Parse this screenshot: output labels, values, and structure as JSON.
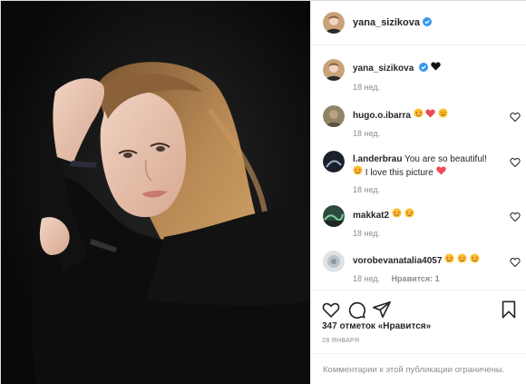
{
  "post": {
    "username": "yana_sizikova",
    "caption_emoji": "black-heart",
    "caption_time": "18 нед."
  },
  "comments": [
    {
      "user": "hugo.o.ibarra",
      "text": "",
      "emojis": [
        "star-struck",
        "red-heart",
        "smiling-face"
      ],
      "time": "18 нед.",
      "likes": ""
    },
    {
      "user": "l.anderbrau",
      "text": "You are so beautiful!",
      "text2": "I love this picture",
      "time": "18 нед.",
      "likes": ""
    },
    {
      "user": "makkat2",
      "text": "",
      "time": "18 нед.",
      "likes": ""
    },
    {
      "user": "vorobevanatalia4057",
      "text": "",
      "time": "18 нед.",
      "likes": "Нравится: 1"
    }
  ],
  "actions": {
    "likes_text": "347 отметок «Нравится»",
    "date": "28 ЯНВАРЯ",
    "comments_closed": "Комментарии к этой публикации ограничены."
  },
  "colors": {
    "verified": "#3897f0",
    "heart": "#ed4956",
    "muted": "#8e8e8e"
  }
}
